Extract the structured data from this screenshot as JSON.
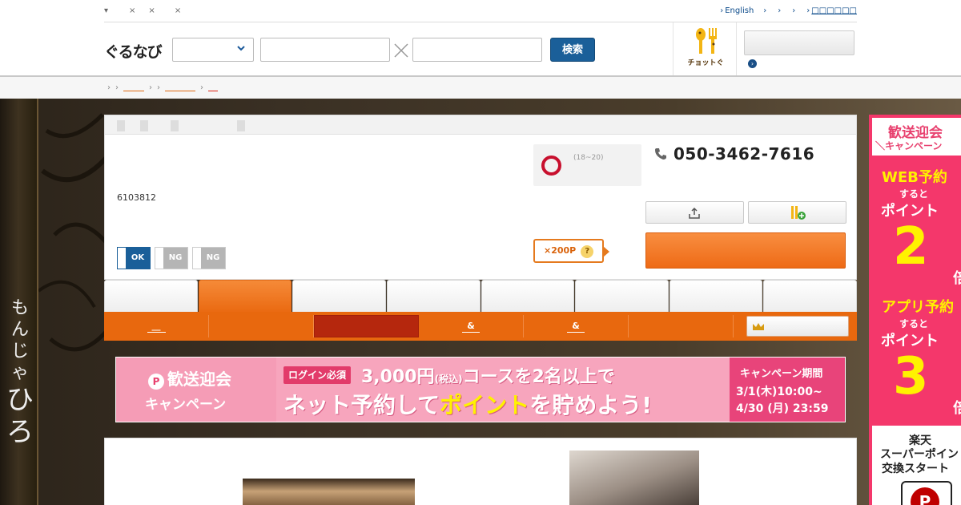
{
  "utility": {
    "left_items": [
      "▾",
      "×",
      "×",
      "×"
    ],
    "right_items": [
      "English",
      "",
      "",
      "",
      "□□□□□□"
    ]
  },
  "header": {
    "logo": "ぐるなび",
    "search_button": "検索",
    "chotto_label": "チョットぐ"
  },
  "breadcrumb": {
    "items": [
      "",
      "",
      "",
      ""
    ]
  },
  "hero": {
    "vertical_small": [
      "も",
      "ん",
      "じ",
      "ゃ"
    ],
    "vertical_big": [
      "ひ",
      "ろ"
    ]
  },
  "shop": {
    "postal": "6103812",
    "time": "(18~20)",
    "phone": "050-3462-7616",
    "toggles": [
      "OK",
      "NG",
      "NG"
    ],
    "points": "×200P",
    "points_help": "?"
  },
  "subnav": {
    "items": [
      "__",
      "",
      "",
      "&",
      "&",
      "",
      ""
    ]
  },
  "banner": {
    "title": "歓送迎会",
    "title2": "キャンペーン",
    "badge": "P",
    "login": "ログイン必須",
    "line1_main": "3,000円",
    "line1_tax": "(税込)",
    "line1_rest": "コースを2名以上で",
    "line2_a": "ネット予約して",
    "line2_b": "ポイント",
    "line2_c": "を貯めよう!",
    "period_head": "キャンペーン期間",
    "period_1": "3/1(木)10:00~",
    "period_2": "4/30 (月) 23:59"
  },
  "side_ad": {
    "t1": "歓送迎会",
    "t2": "＼キャンペーン",
    "web": "WEB予約",
    "suruto1": "すると",
    "point1": "ポイント",
    "num1": "2",
    "bai1": "倍",
    "app": "アプリ予約",
    "suruto2": "すると",
    "point2": "ポイント",
    "num2": "3",
    "bai2": "倍",
    "r1": "楽天",
    "r2": "スーパーポイン",
    "r3": "交換スタート",
    "rp": "P"
  },
  "colors": {
    "accent": "#e8680e",
    "nav_blue": "#1a5f99",
    "campaign_pink": "#f4376b",
    "selected_sub": "#b5270d"
  }
}
